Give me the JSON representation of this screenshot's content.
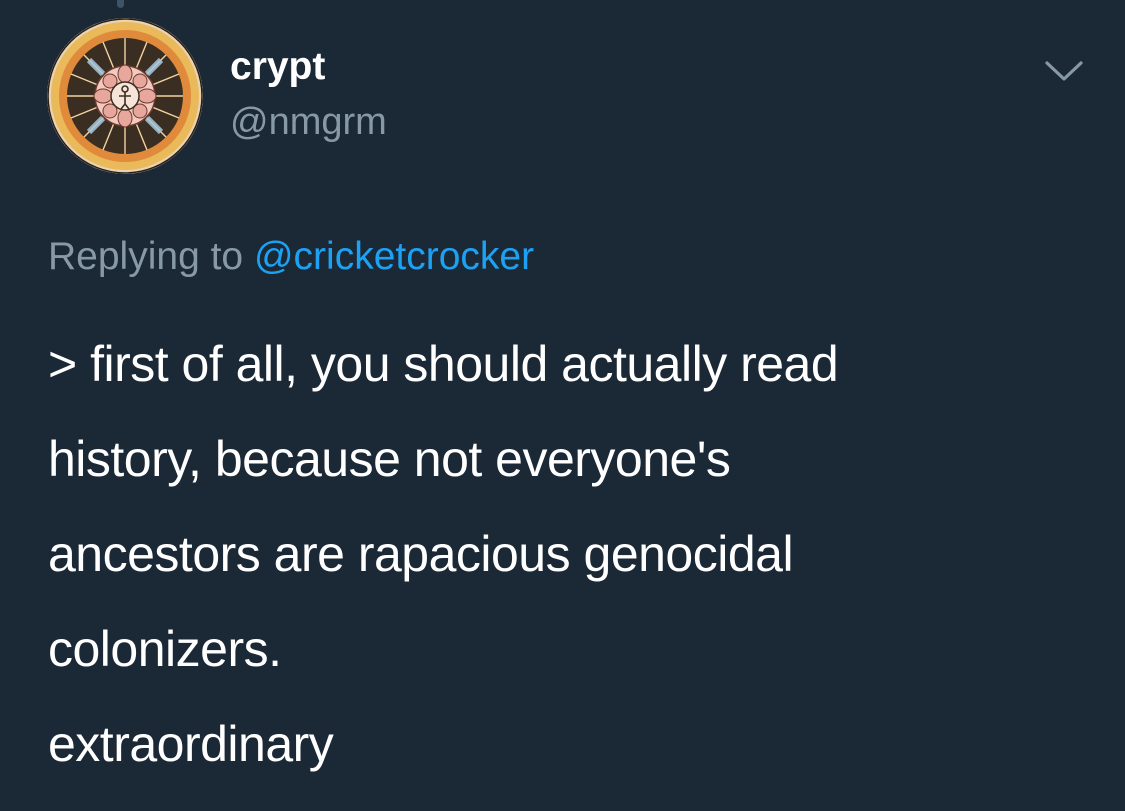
{
  "tweet": {
    "author": {
      "display_name": "crypt",
      "handle": "@nmgrm",
      "avatar_icon": "mandala-avatar"
    },
    "menu_icon": "chevron-down-icon",
    "reply": {
      "prefix": "Replying to",
      "mention": "@cricketcrocker"
    },
    "text": "> first of all, you should actually read\nhistory, because not everyone's\nancestors are rapacious genocidal\ncolonizers.\nextraordinary"
  },
  "colors": {
    "background": "#1b2836",
    "primary_text": "#ffffff",
    "secondary_text": "#8899a6",
    "link": "#1da1f2"
  }
}
